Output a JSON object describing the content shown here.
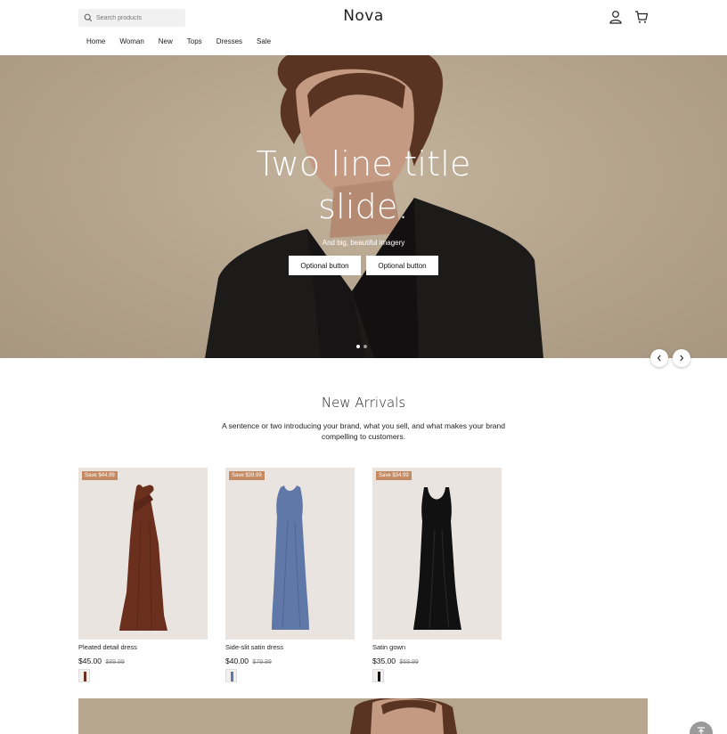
{
  "header": {
    "search_placeholder": "Search products",
    "logo": "Nova",
    "account_icon": "user-icon",
    "cart_icon": "cart-icon"
  },
  "nav": {
    "items": [
      {
        "label": "Home"
      },
      {
        "label": "Woman"
      },
      {
        "label": "New"
      },
      {
        "label": "Tops"
      },
      {
        "label": "Dresses"
      },
      {
        "label": "Sale"
      }
    ]
  },
  "hero": {
    "title": "Two line title slide.",
    "subtitle": "And big, beautiful imagery",
    "button_1": "Optional button",
    "button_2": "Optional button",
    "slides_total": 2,
    "active_slide": 1
  },
  "new_arrivals": {
    "title": "New Arrivals",
    "description": "A sentence or two introducing your brand, what you sell, and what makes your brand compelling to customers.",
    "products": [
      {
        "badge": "Save $44.99",
        "name": "Pleated detail dress",
        "price": "$45.00",
        "compare_price": "$89.99",
        "color": "#6b2f1e"
      },
      {
        "badge": "Save $39.99",
        "name": "Side-slit satin dress",
        "price": "$40.00",
        "compare_price": "$79.99",
        "color": "#5f78a8"
      },
      {
        "badge": "Save $34.99",
        "name": "Satin gown",
        "price": "$35.00",
        "compare_price": "$69.99",
        "color": "#111111"
      }
    ]
  },
  "colors": {
    "badge": "#c48a63",
    "hero_bg": "#b7a68f",
    "product_bg": "#e9e4df"
  }
}
